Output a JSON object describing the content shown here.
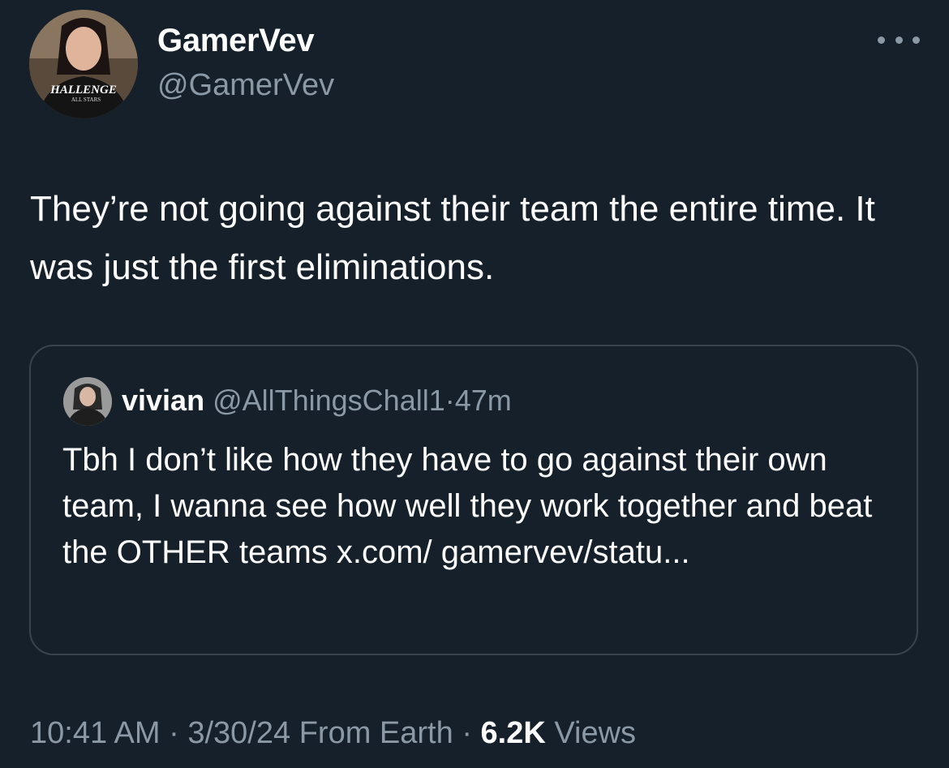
{
  "author": {
    "display_name": "GamerVev",
    "handle": "@GamerVev",
    "avatar_shirt_text": "HALLENGE",
    "avatar_shirt_subtext": "ALL STARS"
  },
  "menu": {
    "more_icon": "more-horizontal-icon"
  },
  "tweet": {
    "text": "They’re not going against their team the entire time. It was just the first eliminations."
  },
  "quoted_tweet": {
    "display_name": "vivian",
    "handle": "@AllThingsChall1",
    "separator": "·",
    "time": "47m",
    "text": "Tbh I don’t like how they have to go against their own team, I wanna see how well they work together and beat the OTHER teams x.com/ gamervev/statu..."
  },
  "meta": {
    "time": "10:41 AM",
    "date": "3/30/24",
    "source": "From Earth",
    "sep1": "·",
    "sep2": "·",
    "views_count": "6.2K",
    "views_label": "Views"
  },
  "colors": {
    "background": "#15202b",
    "primary_text": "#ffffff",
    "secondary_text": "#8b98a5",
    "border": "#38444d"
  }
}
